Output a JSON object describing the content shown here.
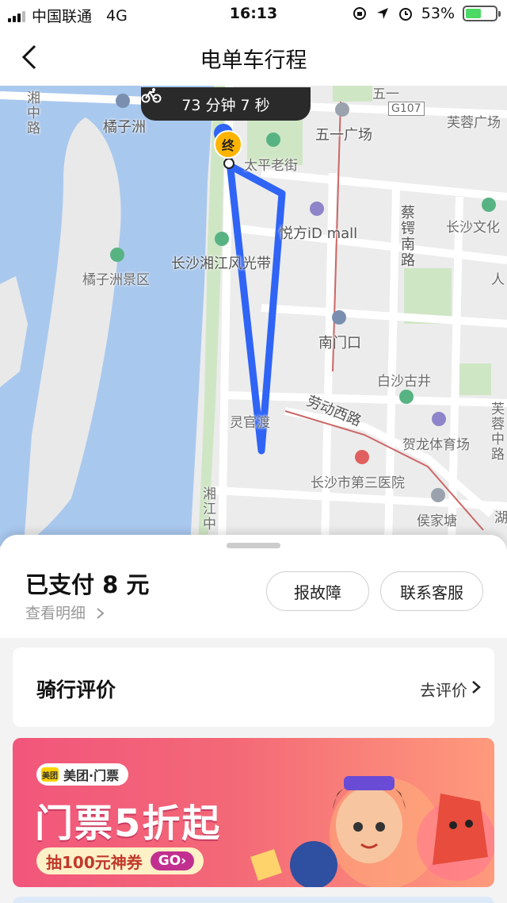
{
  "status_bar": {
    "carrier": "中国联通",
    "network": "4G",
    "time": "16:13",
    "battery": "53%",
    "battery_level": 0.53
  },
  "header": {
    "title": "电单车行程"
  },
  "map": {
    "duration": "73 分钟 7 秒",
    "end_marker": "终",
    "route_color": "#2f64f5",
    "labels": {
      "juzizhou": "橘子洲",
      "juzizhou_scenic": "橘子洲景区",
      "xiangzhong_road": "湘中路",
      "xiangzhong_road_2": "湘江中",
      "taiping_street": "太平老街",
      "wuyi_square": "五一广场",
      "wuyi": "五一",
      "g107": "G107",
      "furong_square": "芙蓉广场",
      "yuefang_mall": "悦方iD mall",
      "xiangjiang_plaza": "长沙湘江风光带",
      "caie_road": "蔡锷南路",
      "changsha_culture": "长沙文化",
      "nanmenkou": "南门口",
      "baisha_well": "白沙古井",
      "laodong_road": "劳动西路",
      "lingguan": "灵官渡",
      "helong_stadium": "贺龙体育场",
      "furong_road": "芙蓉中路",
      "third_hospital": "长沙市第三医院",
      "houjiatang": "侯家塘",
      "hu": "湖",
      "ren": "人"
    }
  },
  "payment": {
    "paid": "已支付 8 元",
    "detail_link": "查看明细"
  },
  "actions": {
    "report_fault": "报故障",
    "contact_service": "联系客服"
  },
  "rating": {
    "title": "骑行评价",
    "action": "去评价"
  },
  "banner": {
    "brand": "美团·门票",
    "brand_logo": "美团",
    "headline": "门票5折起",
    "coupon": "抽100元神券",
    "go": "GO›"
  }
}
